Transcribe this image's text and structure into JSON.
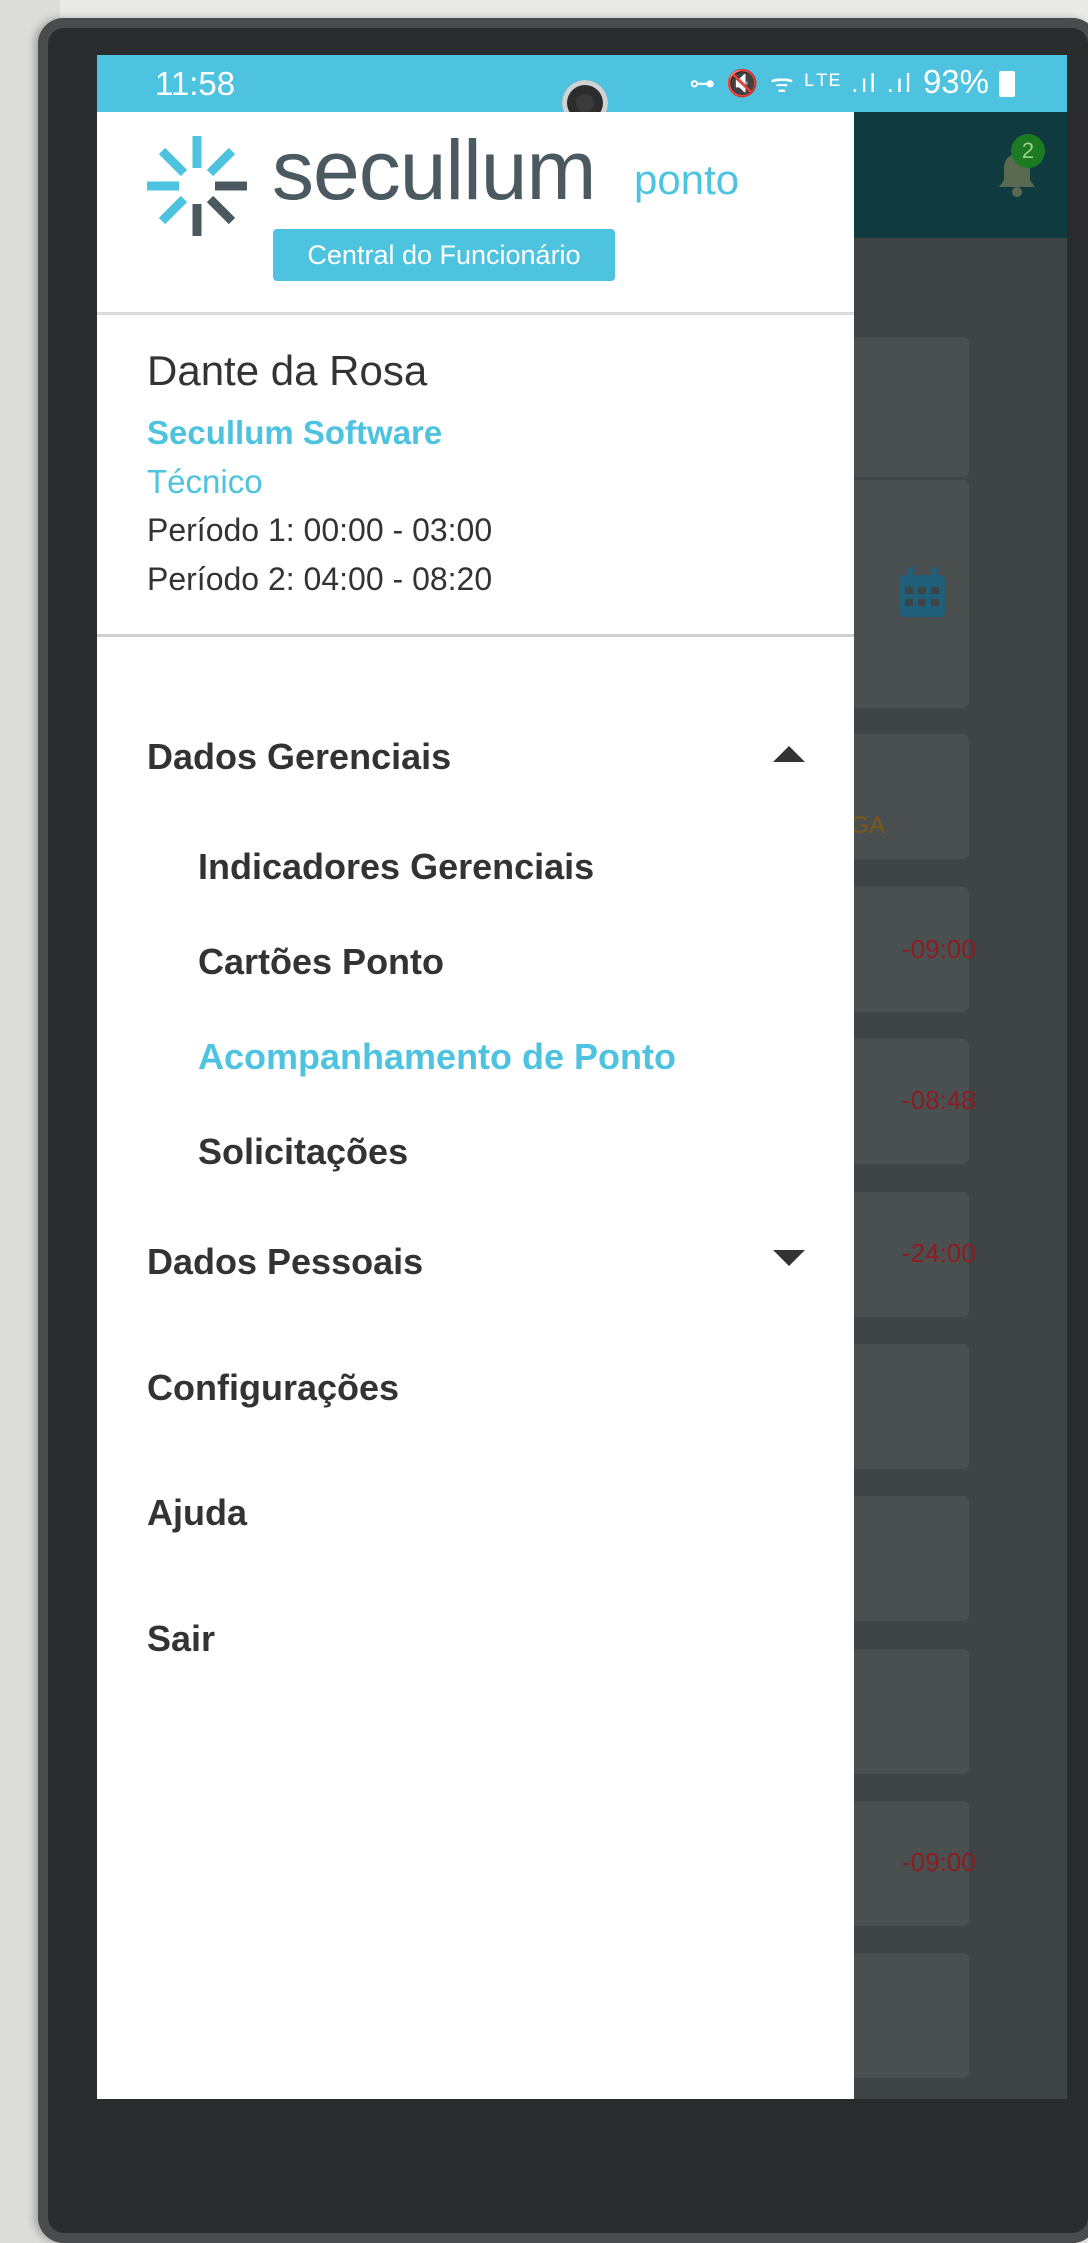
{
  "status_bar": {
    "time": "11:58",
    "icons": "⊶ 🔇 ᯤ ᴸᵀᴱ .ıl .ıl",
    "battery": "93%"
  },
  "background_app": {
    "notification_count": "2",
    "folga_label": "LGA",
    "values": [
      "-09:00",
      "-08:48",
      "-24:00",
      "-09:00"
    ]
  },
  "drawer": {
    "logo": {
      "brand": "secullum",
      "product": "ponto",
      "subtitle": "Central do Funcionário"
    },
    "user": {
      "name": "Dante da Rosa",
      "company": "Secullum Software",
      "role": "Técnico",
      "periods": [
        "Período 1: 00:00 - 03:00",
        "Período 2: 04:00 - 08:20"
      ]
    },
    "menu": {
      "dados_gerenciais": "Dados Gerenciais",
      "submenu": [
        "Indicadores Gerenciais",
        "Cartões Ponto",
        "Acompanhamento de Ponto",
        "Solicitações"
      ],
      "dados_pessoais": "Dados Pessoais",
      "configuracoes": "Configurações",
      "ajuda": "Ajuda",
      "sair": "Sair"
    }
  },
  "nav_bar": {
    "back": "‹",
    "recent": "|||"
  },
  "colors": {
    "accent": "#4ec3e0",
    "text": "#333333",
    "logo_text": "#4b5961"
  }
}
